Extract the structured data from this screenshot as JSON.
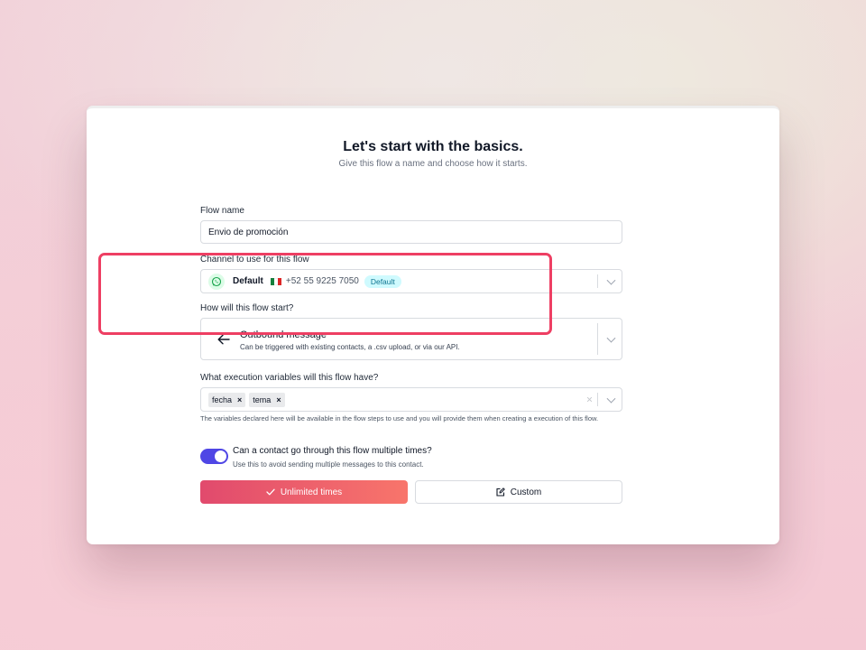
{
  "header": {
    "title": "Let's start with the basics.",
    "subtitle": "Give this flow a name and choose how it starts."
  },
  "flow_name": {
    "label": "Flow name",
    "value": "Envio de promoción"
  },
  "channel": {
    "label": "Channel to use for this flow",
    "name": "Default",
    "phone": "+52 55 9225 7050",
    "badge": "Default",
    "icon": "whatsapp-icon",
    "flag": "mexico-flag-icon"
  },
  "start": {
    "label": "How will this flow start?",
    "option_title": "Outbound message",
    "option_description": "Can be triggered with existing contacts, a .csv upload, or via our API.",
    "icon": "arrow-left-icon"
  },
  "variables": {
    "label": "What execution variables will this flow have?",
    "tags": [
      "fecha",
      "tema"
    ],
    "tag_remove": "×",
    "clear": "×",
    "hint": "The variables declared here will be available in the flow steps to use and you will provide them when creating a execution of this flow."
  },
  "repeat": {
    "title": "Can a contact go through this flow multiple times?",
    "description": "Use this to avoid sending multiple messages to this contact.",
    "enabled": true
  },
  "buttons": {
    "unlimited": "Unlimited times",
    "custom": "Custom"
  },
  "colors": {
    "accent": "#4f46e5",
    "highlight": "#ee3f63",
    "primary_gradient_start": "#e14a6d",
    "primary_gradient_end": "#f8756b",
    "badge_bg": "#cffafe",
    "badge_text": "#0e7490"
  }
}
